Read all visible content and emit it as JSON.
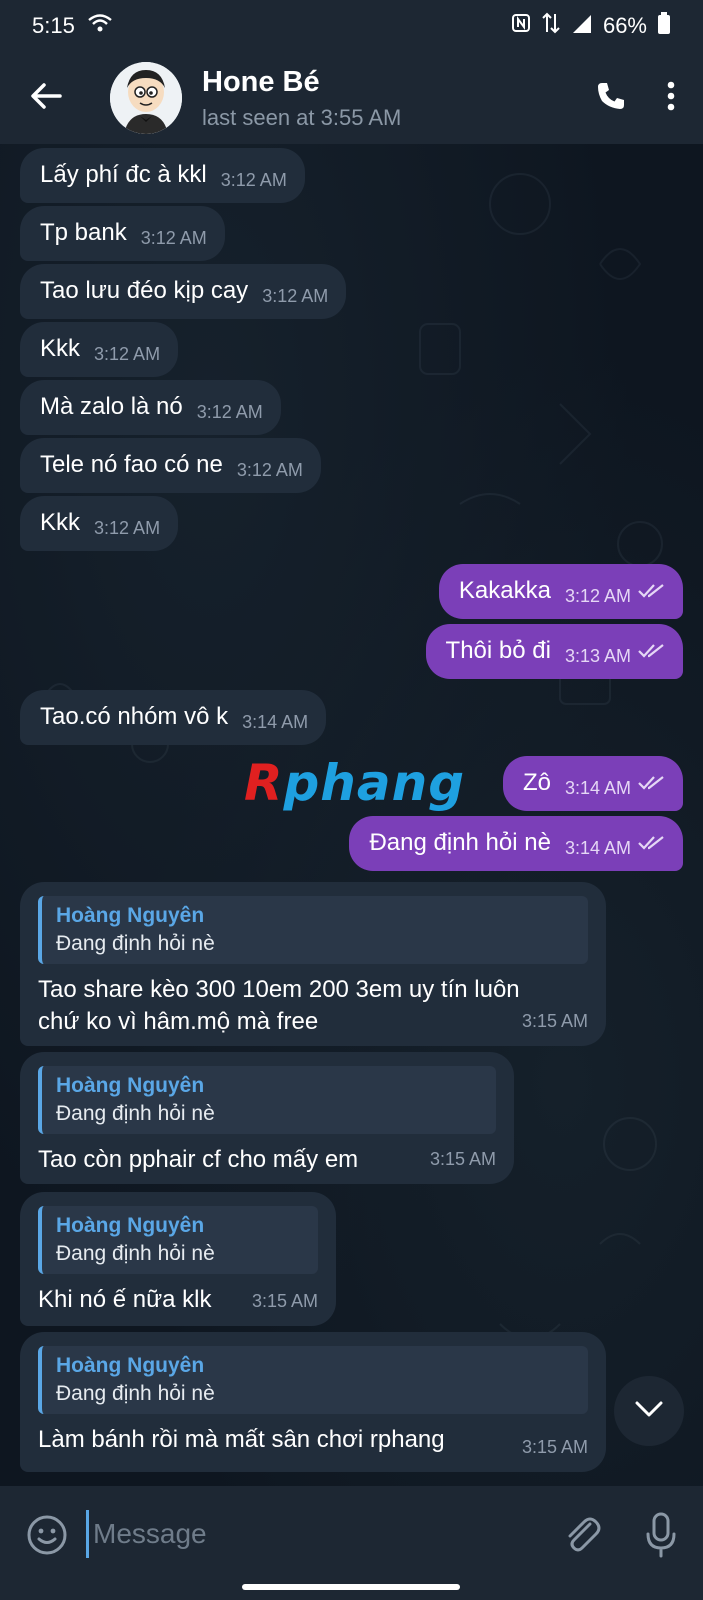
{
  "status_bar": {
    "time": "5:15",
    "battery": "66%"
  },
  "header": {
    "contact_name": "Hone Bé",
    "last_seen": "last seen at 3:55 AM"
  },
  "messages_simple": [
    {
      "text": "Lấy phí đc à kkl",
      "time": "3:12 AM",
      "dir": "in"
    },
    {
      "text": "Tp bank",
      "time": "3:12 AM",
      "dir": "in"
    },
    {
      "text": "Tao lưu đéo kịp cay",
      "time": "3:12 AM",
      "dir": "in"
    },
    {
      "text": "Kkk",
      "time": "3:12 AM",
      "dir": "in"
    },
    {
      "text": "Mà zalo là nó",
      "time": "3:12 AM",
      "dir": "in"
    },
    {
      "text": "Tele nó fao có ne",
      "time": "3:12 AM",
      "dir": "in"
    },
    {
      "text": "Kkk",
      "time": "3:12 AM",
      "dir": "in"
    },
    {
      "text": "Kakakka",
      "time": "3:12 AM",
      "dir": "out"
    },
    {
      "text": "Thôi bỏ đi",
      "time": "3:13 AM",
      "dir": "out"
    },
    {
      "text": "Tao.có nhóm vô k",
      "time": "3:14 AM",
      "dir": "in"
    },
    {
      "text": "Zô",
      "time": "3:14 AM",
      "dir": "out"
    },
    {
      "text": "Đang định hỏi nè",
      "time": "3:14 AM",
      "dir": "out"
    }
  ],
  "messages_reply": [
    {
      "quote_name": "Hoàng Nguyên",
      "quote_text": "Đang định hỏi nè",
      "text": "Tao share kèo 300 10em 200 3em uy tín luôn chứ ko vì hâm.mộ mà free",
      "time": "3:15 AM"
    },
    {
      "quote_name": "Hoàng Nguyên",
      "quote_text": "Đang định hỏi nè",
      "text": "Tao còn pphair cf cho mấy em",
      "time": "3:15 AM"
    },
    {
      "quote_name": "Hoàng Nguyên",
      "quote_text": "Đang định hỏi nè",
      "text": "Khi nó ế nữa klk",
      "time": "3:15 AM"
    },
    {
      "quote_name": "Hoàng Nguyên",
      "quote_text": "Đang định hỏi nè",
      "text": "Làm bánh rồi mà mất sân chơi rphang",
      "time": "3:15 AM"
    }
  ],
  "watermark": {
    "first": "R",
    "rest": "phang"
  },
  "composer": {
    "placeholder": "Message"
  },
  "icons": {
    "back": "arrow-left-icon",
    "call": "phone-icon",
    "more": "more-vertical-icon",
    "emoji": "emoji-icon",
    "attach": "paperclip-icon",
    "mic": "microphone-icon",
    "scroll": "chevron-down-icon"
  },
  "colors": {
    "header_bg": "#1d2733",
    "incoming_bubble": "#212d3b",
    "outgoing_bubble": "#7b3fb8",
    "accent": "#5aa7e6"
  }
}
